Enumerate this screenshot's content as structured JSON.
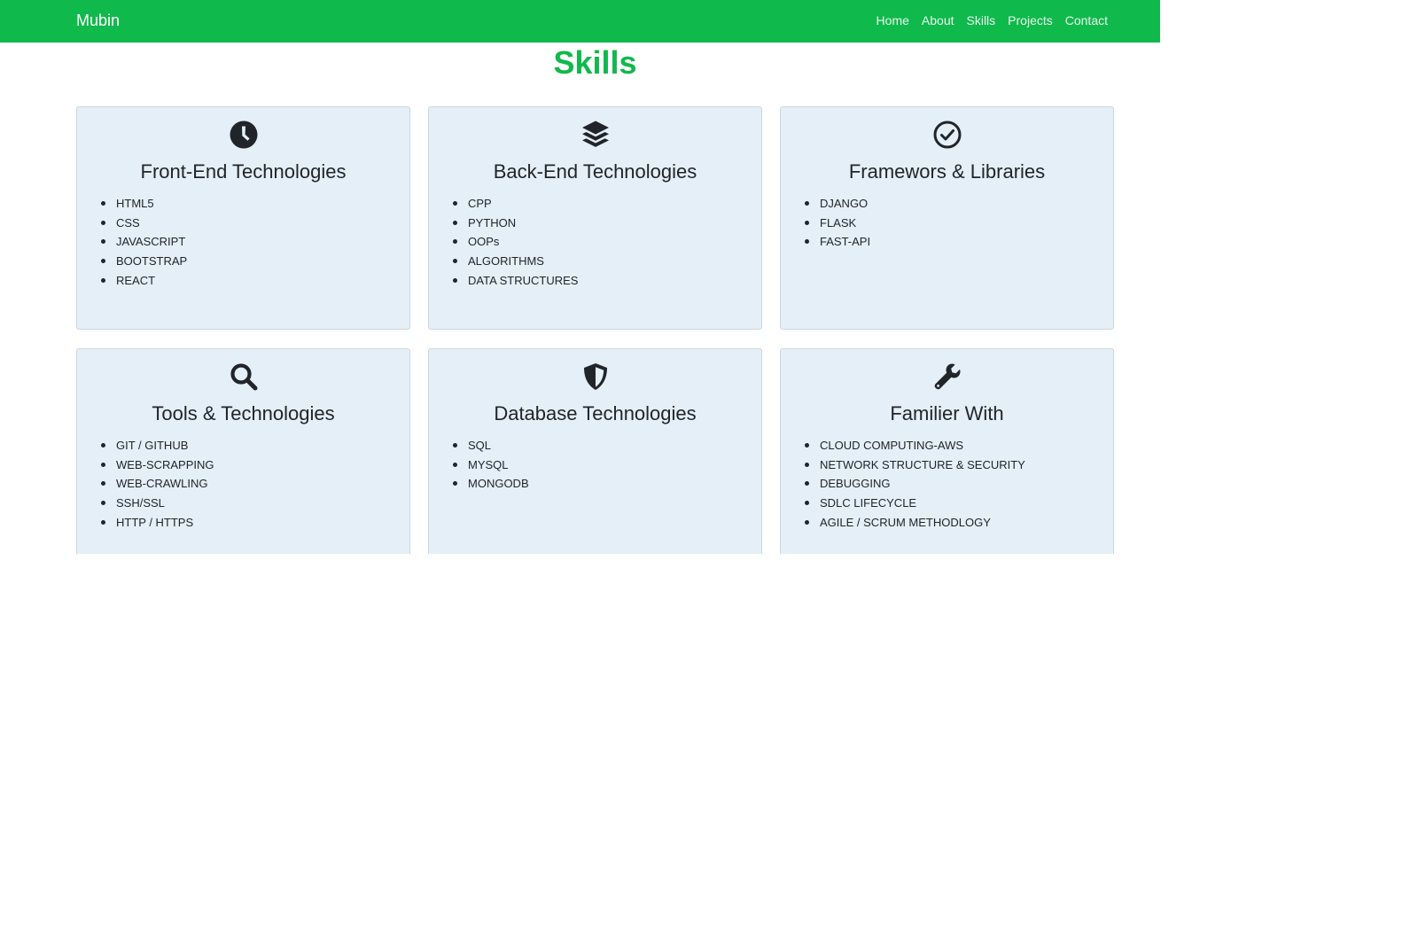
{
  "navbar": {
    "brand": "Mubin",
    "links": [
      "Home",
      "About",
      "Skills",
      "Projects",
      "Contact"
    ],
    "background_color": "#10b94c"
  },
  "section": {
    "title": "Skills",
    "title_color": "#10b94c"
  },
  "cards": [
    {
      "icon": "clock-icon",
      "title": "Front-End Technologies",
      "items": [
        "HTML5",
        "CSS",
        "JAVASCRIPT",
        "BOOTSTRAP",
        "REACT"
      ]
    },
    {
      "icon": "layers-icon",
      "title": "Back-End Technologies",
      "items": [
        "CPP",
        "PYTHON",
        "OOPs",
        "ALGORITHMS",
        "DATA STRUCTURES"
      ]
    },
    {
      "icon": "check-circle-icon",
      "title": "Framewors & Libraries",
      "items": [
        "DJANGO",
        "FLASK",
        "FAST-API"
      ]
    },
    {
      "icon": "search-icon",
      "title": "Tools & Technologies",
      "items": [
        "GIT / GITHUB",
        "WEB-SCRAPPING",
        "WEB-CRAWLING",
        "SSH/SSL",
        "HTTP / HTTPS"
      ]
    },
    {
      "icon": "shield-icon",
      "title": "Database Technologies",
      "items": [
        "SQL",
        "MYSQL",
        "MONGODB"
      ]
    },
    {
      "icon": "wrench-icon",
      "title": "Familier With",
      "items": [
        "CLOUD COMPUTING-AWS",
        "NETWORK STRUCTURE & SECURITY",
        "DEBUGGING",
        "SDLC LIFECYCLE",
        "AGILE / SCRUM METHODLOGY"
      ]
    }
  ],
  "card_background": "#e4eff8"
}
